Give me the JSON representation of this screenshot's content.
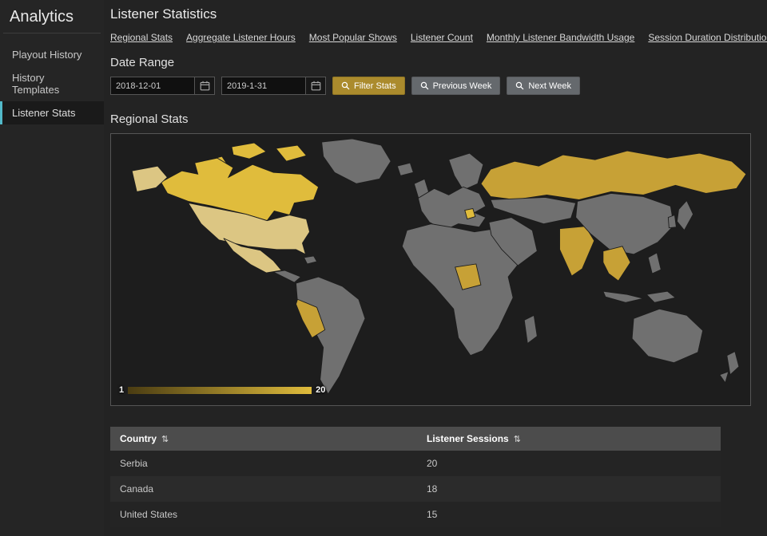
{
  "sidebar": {
    "title": "Analytics",
    "items": [
      {
        "label": "Playout History",
        "active": false
      },
      {
        "label": "History Templates",
        "active": false
      },
      {
        "label": "Listener Stats",
        "active": true
      }
    ]
  },
  "header": {
    "title": "Listener Statistics"
  },
  "nav_links": [
    "Regional Stats",
    "Aggregate Listener Hours",
    "Most Popular Shows",
    "Listener Count",
    "Monthly Listener Bandwidth Usage",
    "Session Duration Distribution"
  ],
  "date_range": {
    "heading": "Date Range",
    "start": "2018-12-01",
    "end": "2019-1-31",
    "filter_label": "Filter Stats",
    "prev_label": "Previous Week",
    "next_label": "Next Week"
  },
  "regional_stats": {
    "heading": "Regional Stats",
    "legend": {
      "min": 1,
      "max": 20
    }
  },
  "table": {
    "columns": [
      "Country",
      "Listener Sessions"
    ],
    "sort_glyph": "⇅",
    "rows": [
      {
        "country": "Serbia",
        "sessions": 20
      },
      {
        "country": "Canada",
        "sessions": 18
      },
      {
        "country": "United States",
        "sessions": 15
      }
    ]
  },
  "chart_data": {
    "type": "heatmap",
    "subtype": "choropleth-world-map",
    "title": "Regional Stats",
    "legend_range": [
      1,
      20
    ],
    "series": [
      {
        "name": "Serbia",
        "value": 20
      },
      {
        "name": "Canada",
        "value": 18
      },
      {
        "name": "United States",
        "value": 15
      }
    ],
    "highlighted_countries": [
      "Canada",
      "United States",
      "Mexico",
      "Peru",
      "Serbia",
      "Russia",
      "India",
      "Nigeria",
      "Thailand"
    ]
  },
  "colors": {
    "bg-main": "#232323",
    "bg-sidebar": "#252525",
    "accent-teal": "#52b9c9",
    "accent-gold": "#ab8b2d",
    "map-gray": "#707070",
    "map-gold": "#c7a136",
    "map-gold-strong": "#e0bc3c",
    "map-gold-pale": "#dcc683"
  }
}
